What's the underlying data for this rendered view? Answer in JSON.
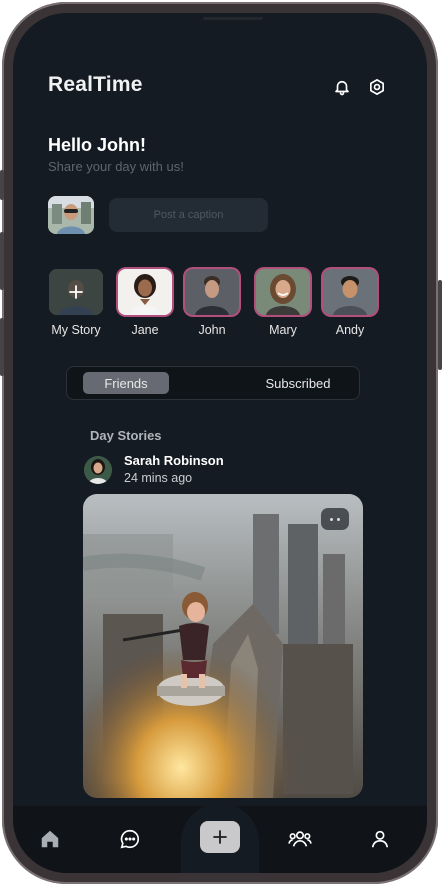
{
  "app": {
    "title": "RealTime"
  },
  "greeting": {
    "title": "Hello John!",
    "subtitle": "Share your day with us!"
  },
  "composer": {
    "placeholder": "Post a caption"
  },
  "stories": [
    {
      "name": "My Story"
    },
    {
      "name": "Jane"
    },
    {
      "name": "John"
    },
    {
      "name": "Mary"
    },
    {
      "name": "Andy"
    }
  ],
  "tabs": [
    {
      "label": "Friends"
    },
    {
      "label": "Subscribed"
    }
  ],
  "feed": {
    "section_title": "Day Stories",
    "post": {
      "author": "Sarah Robinson",
      "time": "24 mins ago"
    }
  },
  "nav": {
    "items": [
      "home-icon",
      "chat-icon",
      "add-icon",
      "friends-icon",
      "profile-icon"
    ]
  },
  "colors": {
    "background": "#151b22",
    "story_ring": "#b24f7c",
    "tab_active": "#676a72"
  }
}
